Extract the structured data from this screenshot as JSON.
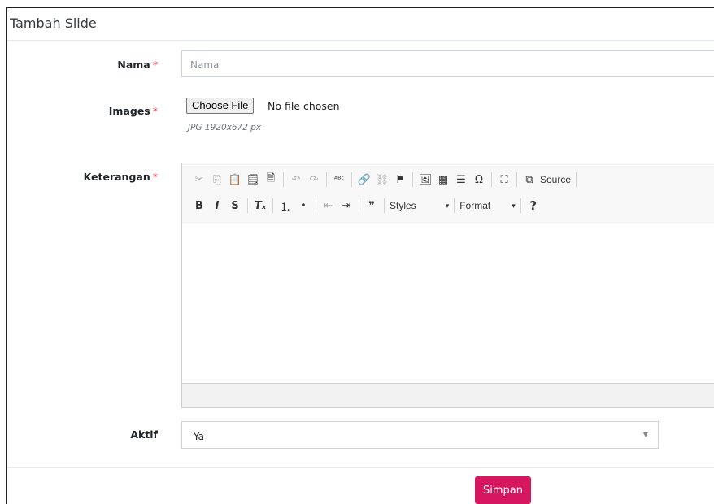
{
  "card": {
    "title": "Tambah Slide"
  },
  "form": {
    "nama": {
      "label": "Nama",
      "required": "*",
      "placeholder": "Nama",
      "value": ""
    },
    "images": {
      "label": "Images",
      "required": "*",
      "button_label": "Choose File",
      "status": "No file chosen",
      "help": "JPG 1920x672 px"
    },
    "keterangan": {
      "label": "Keterangan",
      "required": "*",
      "toolbar_row1": [
        {
          "icon": "cut-icon",
          "glyph": "✂"
        },
        {
          "icon": "copy-icon",
          "glyph": "⎘"
        },
        {
          "icon": "paste-icon",
          "glyph": "📋"
        },
        {
          "icon": "paste-text-icon",
          "glyph": "🗒"
        },
        {
          "icon": "paste-word-icon",
          "glyph": "🗎"
        },
        {
          "icon": "undo-icon",
          "glyph": "↶"
        },
        {
          "icon": "redo-icon",
          "glyph": "↷"
        },
        {
          "icon": "spellcheck-icon",
          "glyph": "ᴬᴮᶜ"
        },
        {
          "icon": "link-icon",
          "glyph": "🔗"
        },
        {
          "icon": "unlink-icon",
          "glyph": "⛓"
        },
        {
          "icon": "anchor-flag-icon",
          "glyph": "⚑"
        },
        {
          "icon": "image-icon",
          "glyph": "🖼"
        },
        {
          "icon": "table-icon",
          "glyph": "▦"
        },
        {
          "icon": "horizontal-rule-icon",
          "glyph": "☰"
        },
        {
          "icon": "special-char-icon",
          "glyph": "Ω"
        },
        {
          "icon": "maximize-icon",
          "glyph": "⛶"
        },
        {
          "icon": "source-icon",
          "glyph": "⧉"
        }
      ],
      "source_label": "Source",
      "toolbar_row2": [
        {
          "icon": "bold-icon",
          "glyph": "B"
        },
        {
          "icon": "italic-icon",
          "glyph": "I"
        },
        {
          "icon": "strike-icon",
          "glyph": "S"
        },
        {
          "icon": "remove-format-icon",
          "glyph": "Tₓ"
        },
        {
          "icon": "numbered-list-icon",
          "glyph": "⒈"
        },
        {
          "icon": "bullet-list-icon",
          "glyph": "•"
        },
        {
          "icon": "outdent-icon",
          "glyph": "⇤"
        },
        {
          "icon": "indent-icon",
          "glyph": "⇥"
        },
        {
          "icon": "blockquote-icon",
          "glyph": "❞"
        }
      ],
      "styles_label": "Styles",
      "format_label": "Format",
      "help_glyph": "?"
    },
    "aktif": {
      "label": "Aktif",
      "value": "Ya"
    }
  },
  "actions": {
    "save_label": "Simpan"
  },
  "colors": {
    "primary": "#d6175f",
    "required": "#dc3545"
  }
}
